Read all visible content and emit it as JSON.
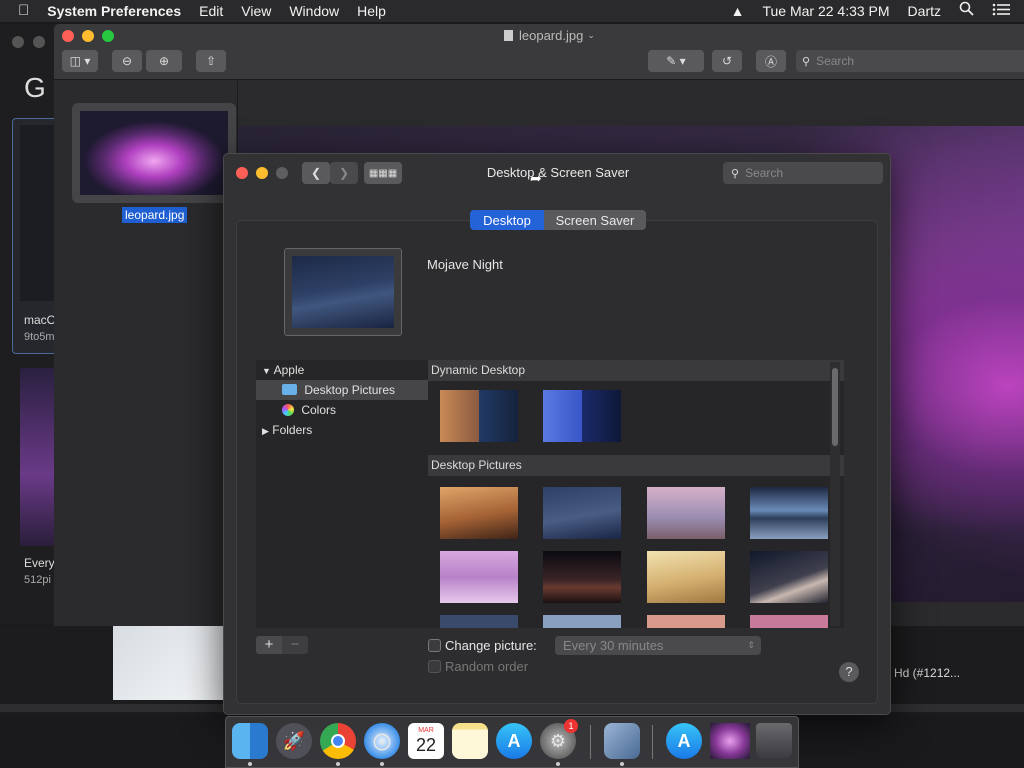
{
  "menubar": {
    "app": "System Preferences",
    "items": [
      "Edit",
      "View",
      "Window",
      "Help"
    ],
    "datetime": "Tue Mar 22  4:33 PM",
    "user": "Dartz"
  },
  "browser": {
    "letter": "G",
    "card1_name": "macO",
    "card1_sub": "9to5m",
    "card2_name": "Every",
    "card2_sub": "512pi",
    "right_label": "Hd (#1212..."
  },
  "preview": {
    "filename": "leopard.jpg",
    "thumb_label": "leopard.jpg",
    "search_placeholder": "Search"
  },
  "prefs": {
    "title": "Desktop & Screen Saver",
    "search_placeholder": "Search",
    "tabs": [
      "Desktop",
      "Screen Saver"
    ],
    "current_picture": "Mojave Night",
    "tree": {
      "apple": "Apple",
      "desktop_pictures": "Desktop Pictures",
      "colors": "Colors",
      "folders": "Folders"
    },
    "sections": {
      "dynamic": "Dynamic Desktop",
      "pictures": "Desktop Pictures"
    },
    "add_btn": "+",
    "remove_btn": "−",
    "change_picture": "Change picture:",
    "interval": "Every 30 minutes",
    "random_order": "Random order",
    "help": "?"
  },
  "dock": {
    "calendar_month": "MAR",
    "calendar_day": "22",
    "badge": "1"
  }
}
